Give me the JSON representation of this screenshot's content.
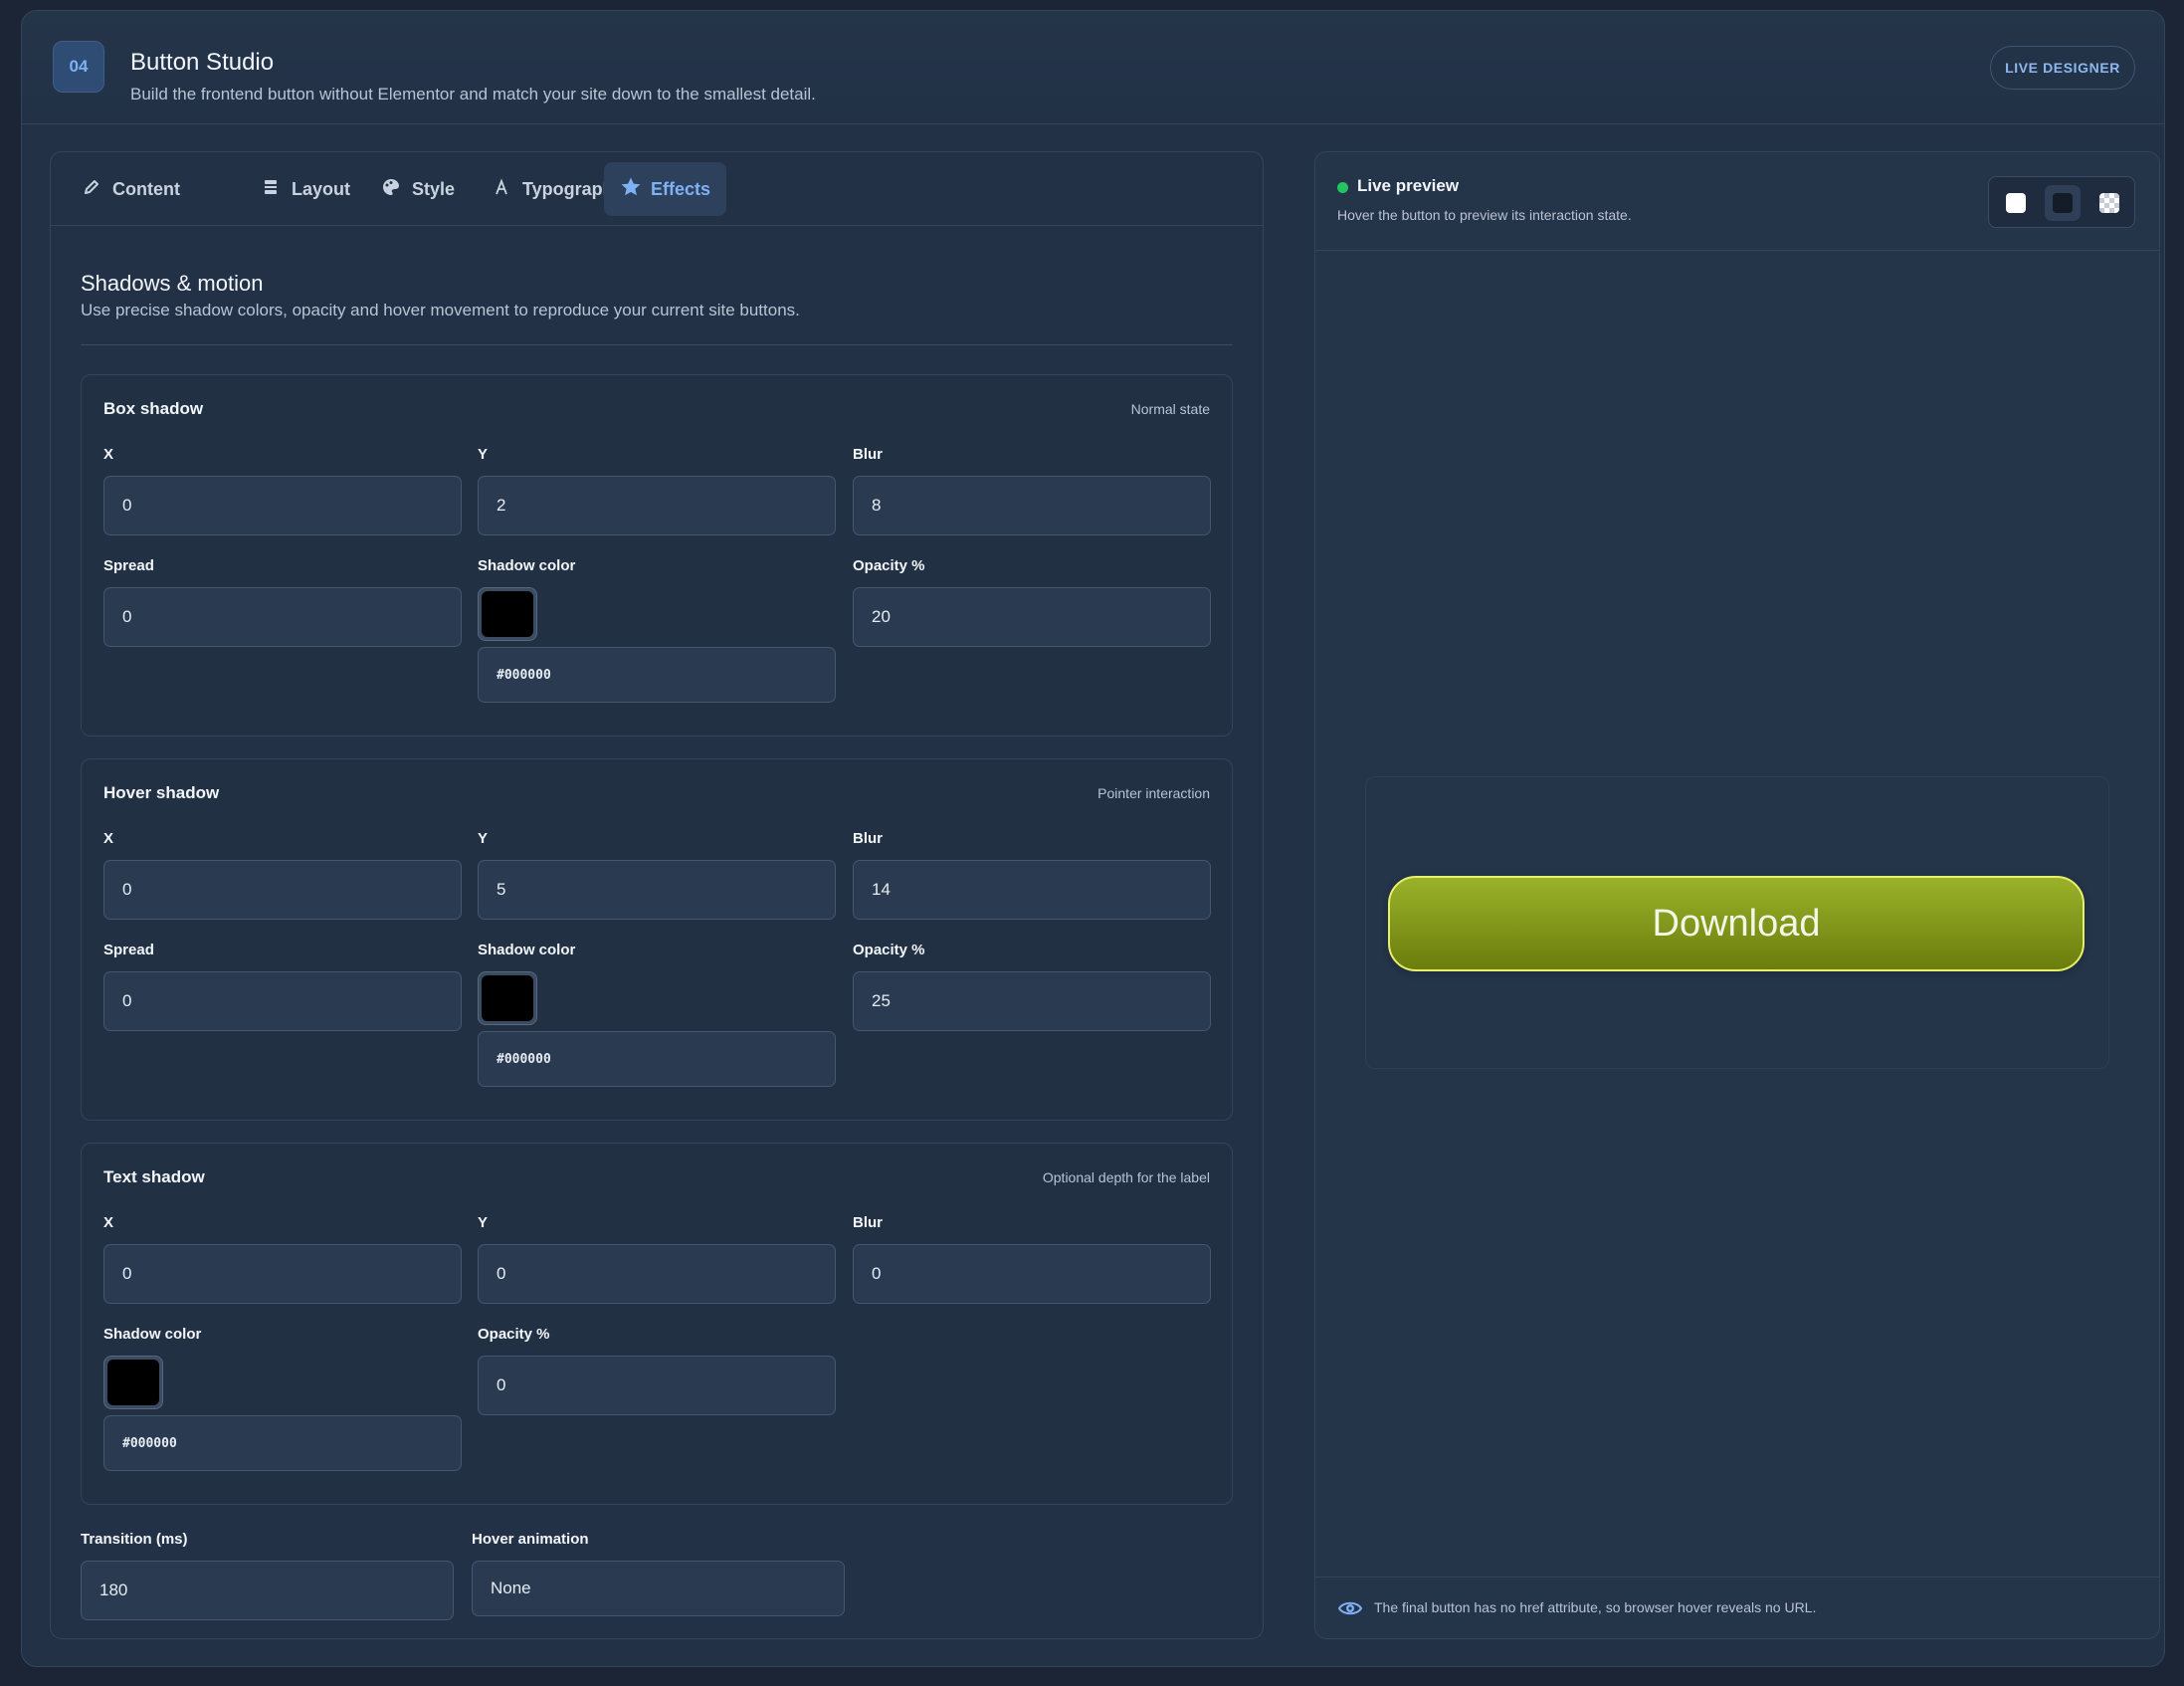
{
  "header": {
    "step_number": "04",
    "title": "Button Studio",
    "subtitle": "Build the frontend button without Elementor and match your site down to the smallest detail.",
    "badge": "LIVE DESIGNER"
  },
  "tabs": [
    {
      "label": "Content",
      "icon": "pencil-icon"
    },
    {
      "label": "Layout",
      "icon": "layout-icon"
    },
    {
      "label": "Style",
      "icon": "palette-icon"
    },
    {
      "label": "Typography",
      "icon": "typography-icon"
    },
    {
      "label": "Effects",
      "icon": "star-icon",
      "active": true
    }
  ],
  "section": {
    "title": "Shadows & motion",
    "subtitle": "Use precise shadow colors, opacity and hover movement to reproduce your current site buttons."
  },
  "box_shadow": {
    "title": "Box shadow",
    "note": "Normal state",
    "x_label": "X",
    "x": "0",
    "y_label": "Y",
    "y": "2",
    "blur_label": "Blur",
    "blur": "8",
    "spread_label": "Spread",
    "spread": "0",
    "color_label": "Shadow color",
    "color": "#000000",
    "opacity_label": "Opacity %",
    "opacity": "20"
  },
  "hover_shadow": {
    "title": "Hover shadow",
    "note": "Pointer interaction",
    "x_label": "X",
    "x": "0",
    "y_label": "Y",
    "y": "5",
    "blur_label": "Blur",
    "blur": "14",
    "spread_label": "Spread",
    "spread": "0",
    "color_label": "Shadow color",
    "color": "#000000",
    "opacity_label": "Opacity %",
    "opacity": "25"
  },
  "text_shadow": {
    "title": "Text shadow",
    "note": "Optional depth for the label",
    "x_label": "X",
    "x": "0",
    "y_label": "Y",
    "y": "0",
    "blur_label": "Blur",
    "blur": "0",
    "color_label": "Shadow color",
    "color": "#000000",
    "opacity_label": "Opacity %",
    "opacity": "0"
  },
  "motion": {
    "transition_label": "Transition (ms)",
    "transition": "180",
    "animation_label": "Hover animation",
    "animation": "None"
  },
  "preview": {
    "title": "Live preview",
    "subtitle": "Hover the button to preview its interaction state.",
    "status_color": "#22c55e",
    "backgrounds": [
      "white",
      "dark",
      "checkered"
    ],
    "active_background": "dark",
    "button_label": "Download",
    "button_colors": {
      "gradient_top": "#9ab22a",
      "gradient_bottom": "#6b7d0d",
      "border": "#e6f06a"
    },
    "footer_note": "The final button has no href attribute, so browser hover reveals no URL."
  }
}
